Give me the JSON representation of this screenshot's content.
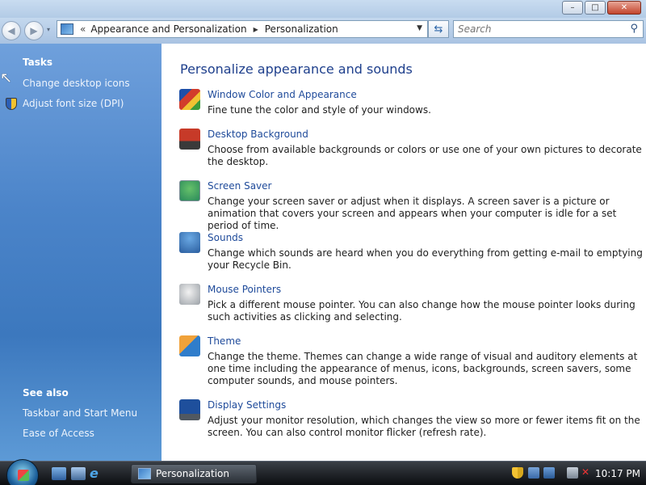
{
  "window": {
    "controls": {
      "minimize": "–",
      "maximize": "□",
      "close": "✕"
    }
  },
  "nav": {
    "back_glyph": "◀",
    "forward_glyph": "▶",
    "history_glyph": "▾",
    "address": {
      "overflow_chevron": "«",
      "crumbs": [
        "Appearance and Personalization",
        "Personalization"
      ],
      "separator": "▶",
      "dropdown_glyph": "▼"
    },
    "refresh_glyph": "⇆",
    "search": {
      "placeholder": "Search",
      "icon": "search-icon",
      "glyph": "⚲"
    }
  },
  "sidebar": {
    "tasks_heading": "Tasks",
    "tasks": [
      {
        "label": "Change desktop icons"
      },
      {
        "label": "Adjust font size (DPI)",
        "icon": "uac-shield-icon"
      }
    ],
    "see_also_heading": "See also",
    "see_also": [
      {
        "label": "Taskbar and Start Menu"
      },
      {
        "label": "Ease of Access"
      }
    ],
    "cursor_glyph": "↖"
  },
  "main": {
    "title": "Personalize appearance and sounds",
    "items": [
      {
        "title": "Window Color and Appearance",
        "desc": "Fine tune the color and style of your windows.",
        "icon": "window-color-icon"
      },
      {
        "title": "Desktop Background",
        "desc": "Choose from available backgrounds or colors or use one of your own pictures to decorate the desktop.",
        "icon": "desktop-background-icon"
      },
      {
        "title": "Screen Saver",
        "desc": "Change your screen saver or adjust when it displays. A screen saver is a picture or animation that covers your screen and appears when your computer is idle for a set period of time.",
        "icon": "screen-saver-icon"
      },
      {
        "title": "Sounds",
        "desc": "Change which sounds are heard when you do everything from getting e-mail to emptying your Recycle Bin.",
        "icon": "sounds-icon"
      },
      {
        "title": "Mouse Pointers",
        "desc": "Pick a different mouse pointer. You can also change how the mouse pointer looks during such activities as clicking and selecting.",
        "icon": "mouse-pointer-icon"
      },
      {
        "title": "Theme",
        "desc": "Change the theme. Themes can change a wide range of visual and auditory elements at one time including the appearance of menus, icons, backgrounds, screen savers, some computer sounds, and mouse pointers.",
        "icon": "theme-icon"
      },
      {
        "title": "Display Settings",
        "desc": "Adjust your monitor resolution, which changes the view so more or fewer items fit on the screen. You can also control monitor flicker (refresh rate).",
        "icon": "display-settings-icon"
      }
    ]
  },
  "taskbar": {
    "quick_launch": [
      "show-desktop-icon",
      "switch-windows-icon",
      "internet-explorer-icon"
    ],
    "ie_glyph": "e",
    "active_window": "Personalization",
    "tray": {
      "volume_glyph": "✕",
      "clock": "10:17 PM"
    }
  }
}
